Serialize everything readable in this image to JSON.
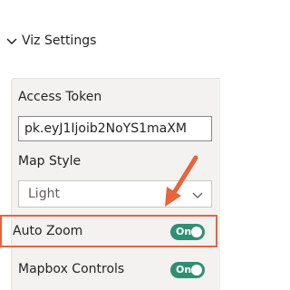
{
  "section": {
    "title": "Viz Settings",
    "expanded": true
  },
  "fields": {
    "access_token": {
      "label": "Access Token",
      "value": "pk.eyJ1Ijoib2NoYS1maXM"
    },
    "map_style": {
      "label": "Map Style",
      "selected": "Light"
    },
    "auto_zoom": {
      "label": "Auto Zoom",
      "toggle_text": "On",
      "state": "on"
    },
    "mapbox_controls": {
      "label": "Mapbox Controls",
      "toggle_text": "On",
      "state": "on"
    }
  },
  "colors": {
    "toggle_on": "#2f8f73",
    "highlight": "#e7643c",
    "annotation_arrow": "#e7643c"
  },
  "icons": {
    "section_chevron": "chevron-down-icon",
    "select_caret": "chevron-down-icon",
    "annotation": "arrow-icon"
  }
}
